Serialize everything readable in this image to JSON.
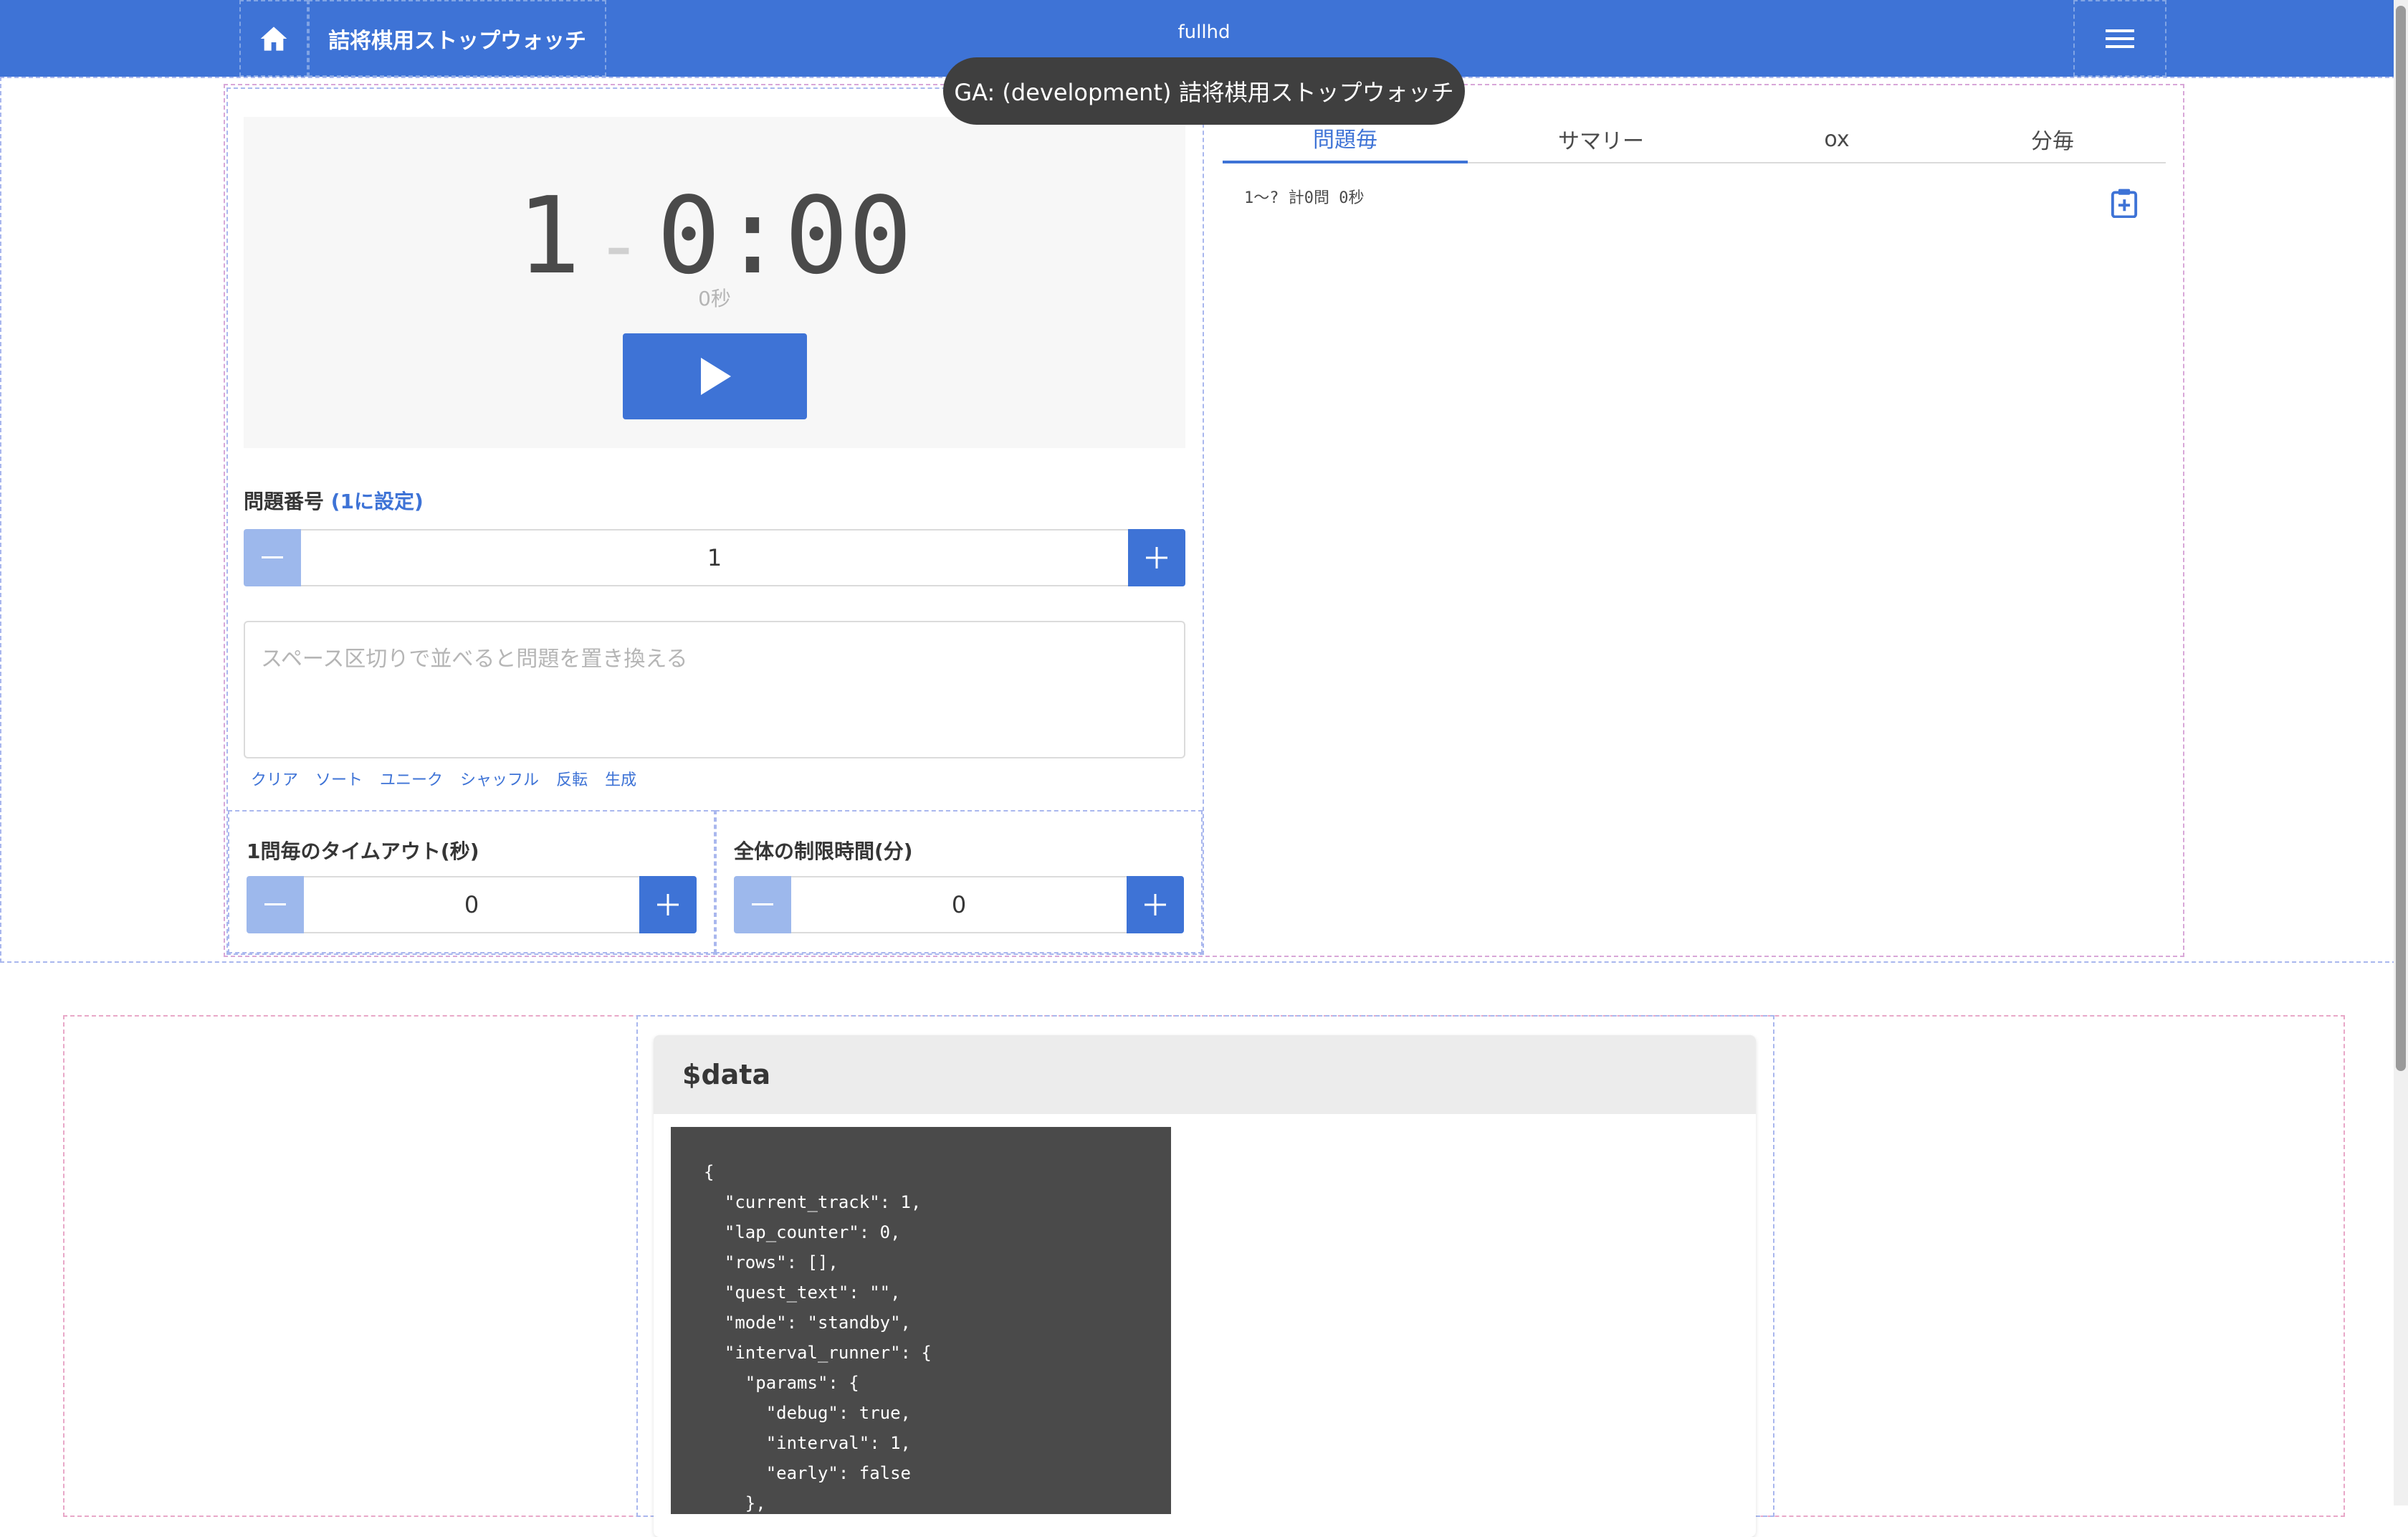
{
  "nav": {
    "title": "詰将棋用ストップウォッチ",
    "env": "fullhd",
    "icons": {
      "home": "home-icon",
      "menu": "hamburger-menu-icon"
    }
  },
  "toast": "GA: (development) 詰将棋用ストップウォッチ",
  "timer": {
    "track": "1",
    "separator": "-",
    "time": "0:00",
    "seconds_label": "0秒"
  },
  "question": {
    "label": "問題番号",
    "reset_link": "(1に設定)",
    "value": "1"
  },
  "quest_text": {
    "placeholder": "スペース区切りで並べると問題を置き換える",
    "actions": [
      "クリア",
      "ソート",
      "ユニーク",
      "シャッフル",
      "反転",
      "生成"
    ]
  },
  "timeout": {
    "label": "1問毎のタイムアウト(秒)",
    "value": "0"
  },
  "limit": {
    "label": "全体の制限時間(分)",
    "value": "0"
  },
  "tabs": [
    "問題毎",
    "サマリー",
    "ox",
    "分毎"
  ],
  "active_tab": 0,
  "summary": "1〜? 計0問 0秒",
  "debug": {
    "title": "$data",
    "code": "{\n  \"current_track\": 1,\n  \"lap_counter\": 0,\n  \"rows\": [],\n  \"quest_text\": \"\",\n  \"mode\": \"standby\",\n  \"interval_runner\": {\n    \"params\": {\n      \"debug\": true,\n      \"interval\": 1,\n      \"early\": false\n    },"
  },
  "colors": {
    "primary": "#3e73d6",
    "primary_light": "#9db8ec"
  }
}
